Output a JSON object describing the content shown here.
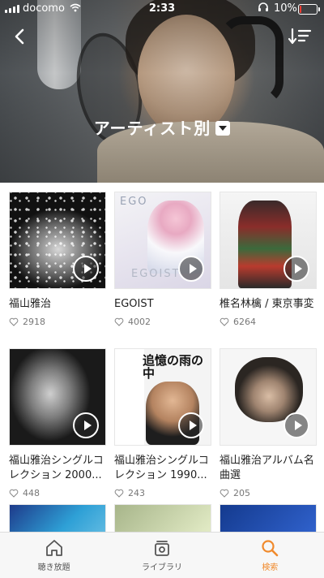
{
  "status": {
    "carrier": "docomo",
    "time": "2:33",
    "battery": "10%",
    "battery_color": "#ff3b30"
  },
  "header": {
    "title": "アーティスト別"
  },
  "grid": {
    "items": [
      {
        "title": "福山雅治",
        "likes": "2918"
      },
      {
        "title": "EGOIST",
        "likes": "4002",
        "art_text_1": "EGO",
        "art_text_2": "EGOIST"
      },
      {
        "title": "椎名林檎 / 東京事変",
        "likes": "6264"
      },
      {
        "title": "福山雅治シングルコレクション 2000...",
        "likes": "448"
      },
      {
        "title": "福山雅治シングルコレクション 1990...",
        "likes": "243",
        "art_text": "追憶の雨の中"
      },
      {
        "title": "福山雅治アルバム名曲選",
        "likes": "205"
      }
    ]
  },
  "tabbar": {
    "tabs": [
      {
        "label": "聴き放題"
      },
      {
        "label": "ライブラリ"
      },
      {
        "label": "検索",
        "active": true
      }
    ],
    "accent": "#f08a2c"
  }
}
